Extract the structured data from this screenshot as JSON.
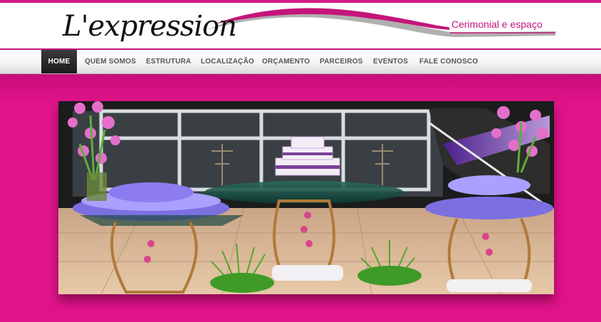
{
  "header": {
    "logo": "L'expression",
    "tagline": "Cerimonial e espaço"
  },
  "nav": {
    "items": [
      {
        "id": "home",
        "label": "HOME",
        "active": true
      },
      {
        "id": "quem-somos",
        "label": "QUEM SOMOS"
      },
      {
        "id": "estrutura",
        "label": "ESTRUTURA"
      },
      {
        "id": "localizacao",
        "label": "LOCALIZAÇÃO"
      },
      {
        "id": "orcamento",
        "label": "ORÇAMENTO"
      },
      {
        "id": "parceiros",
        "label": "PARCEIROS"
      },
      {
        "id": "eventos",
        "label": "EVENTOS"
      },
      {
        "id": "fale-conosco",
        "label": "FALE CONOSCO"
      }
    ]
  },
  "colors": {
    "brand": "#e0128a",
    "accent": "#c0157d",
    "nav_active": "#222222"
  }
}
